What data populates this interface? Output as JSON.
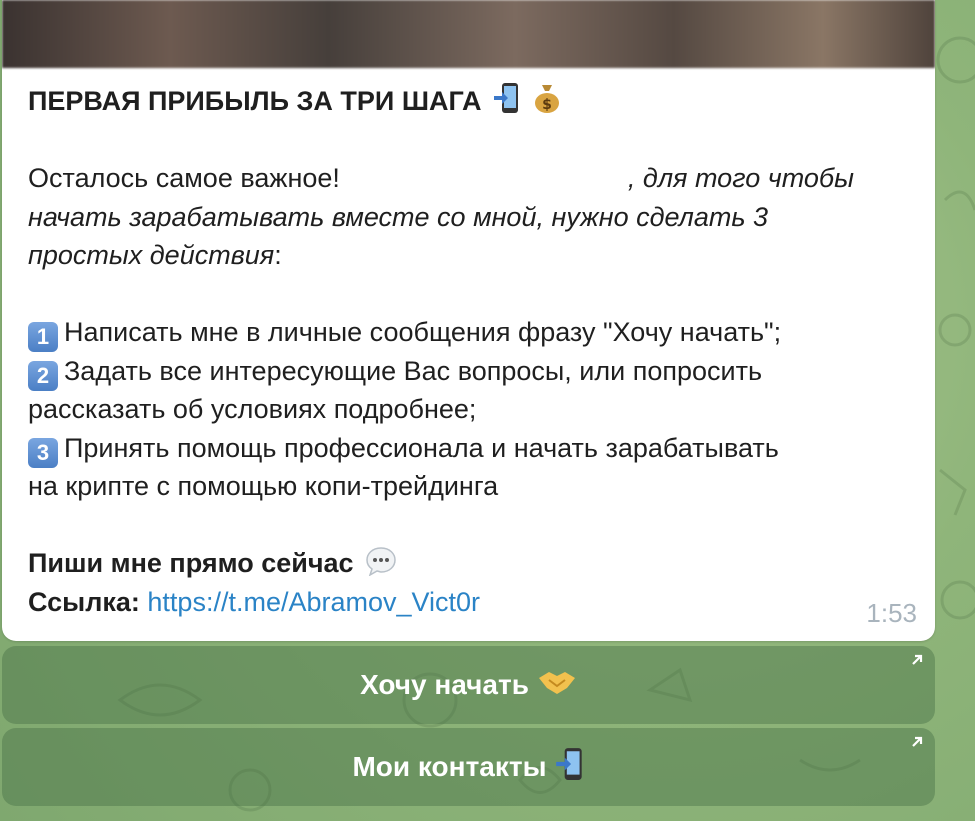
{
  "message": {
    "heading": "ПЕРВАЯ ПРИБЫЛЬ ЗА ТРИ ШАГА",
    "intro_plain": "Осталось самое важное!",
    "intro_italic_1": ", для того чтобы",
    "intro_italic_2": "начать зарабатывать вместе со мной, нужно сделать 3",
    "intro_italic_3": "простых действия",
    "intro_colon": ":",
    "steps": [
      {
        "number": "1",
        "lines": [
          "Написать мне в личные сообщения фразу \"Хочу начать\";"
        ]
      },
      {
        "number": "2",
        "lines": [
          "Задать все интересующие Вас вопросы, или попросить",
          "рассказать об условиях подробнее;"
        ]
      },
      {
        "number": "3",
        "lines": [
          "Принять помощь профессионала и начать зарабатывать",
          "на крипте с помощью копи-трейдинга"
        ]
      }
    ],
    "cta": "Пиши мне прямо сейчас",
    "link_label": "Ссылка:",
    "link_url": "https://t.me/Abramov_Vict0r",
    "time": "1:53"
  },
  "buttons": [
    {
      "label": "Хочу начать",
      "icon": "handshake-icon"
    },
    {
      "label": "Мои контакты",
      "icon": "phone-arrow-icon"
    }
  ],
  "colors": {
    "link": "#2a83c6",
    "chat_background": "#8fb57a",
    "bubble": "#ffffff"
  }
}
